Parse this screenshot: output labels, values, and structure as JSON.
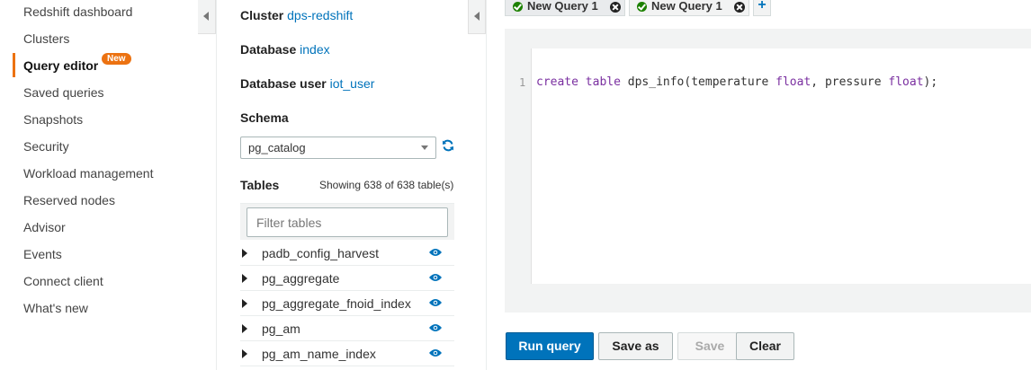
{
  "nav": {
    "items": [
      {
        "label": "Redshift dashboard"
      },
      {
        "label": "Clusters"
      },
      {
        "label": "Query editor",
        "active": true,
        "badge": "New"
      },
      {
        "label": "Saved queries"
      },
      {
        "label": "Snapshots"
      },
      {
        "label": "Security"
      },
      {
        "label": "Workload management"
      },
      {
        "label": "Reserved nodes"
      },
      {
        "label": "Advisor"
      },
      {
        "label": "Events"
      },
      {
        "label": "Connect client"
      },
      {
        "label": "What's new"
      }
    ],
    "accent_color": "#ec7211"
  },
  "connection": {
    "cluster_label": "Cluster",
    "cluster_value": "dps-redshift",
    "database_label": "Database",
    "database_value": "index",
    "user_label": "Database user",
    "user_value": "iot_user"
  },
  "schema": {
    "title": "Schema",
    "selected": "pg_catalog",
    "refresh_icon": "refresh-icon"
  },
  "tables": {
    "title": "Tables",
    "showing": "Showing 638 of 638 table(s)",
    "filter_placeholder": "Filter tables",
    "rows": [
      {
        "name": "padb_config_harvest"
      },
      {
        "name": "pg_aggregate"
      },
      {
        "name": "pg_aggregate_fnoid_index"
      },
      {
        "name": "pg_am"
      },
      {
        "name": "pg_am_name_index"
      }
    ]
  },
  "editor": {
    "tabs": [
      {
        "label": "New Query 1",
        "status_icon": "check-circle-icon",
        "close_icon": "close-icon"
      },
      {
        "label": "New Query 1",
        "status_icon": "check-circle-icon",
        "close_icon": "close-icon"
      }
    ],
    "add_tab_label": "+",
    "line_number": "1",
    "code": "create table dps_info(temperature float, pressure float);",
    "keyword_color": "#7a2fa0"
  },
  "actions": {
    "run": "Run query",
    "save_as": "Save as",
    "save": "Save",
    "clear": "Clear",
    "primary_color": "#0073bb"
  }
}
